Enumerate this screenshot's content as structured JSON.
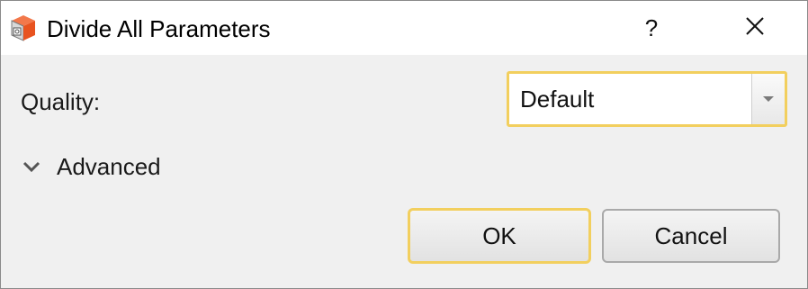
{
  "window": {
    "title": "Divide All Parameters",
    "icon": "app-cube-icon",
    "help_label": "?",
    "close_icon": "close-icon"
  },
  "form": {
    "quality_label": "Quality:",
    "quality_value": "Default",
    "advanced_label": "Advanced",
    "advanced_expanded": false
  },
  "buttons": {
    "ok_label": "OK",
    "cancel_label": "Cancel"
  },
  "colors": {
    "focus_accent": "#f2cf5e",
    "icon_orange": "#e8531f",
    "dialog_background": "#f0f0f0"
  }
}
